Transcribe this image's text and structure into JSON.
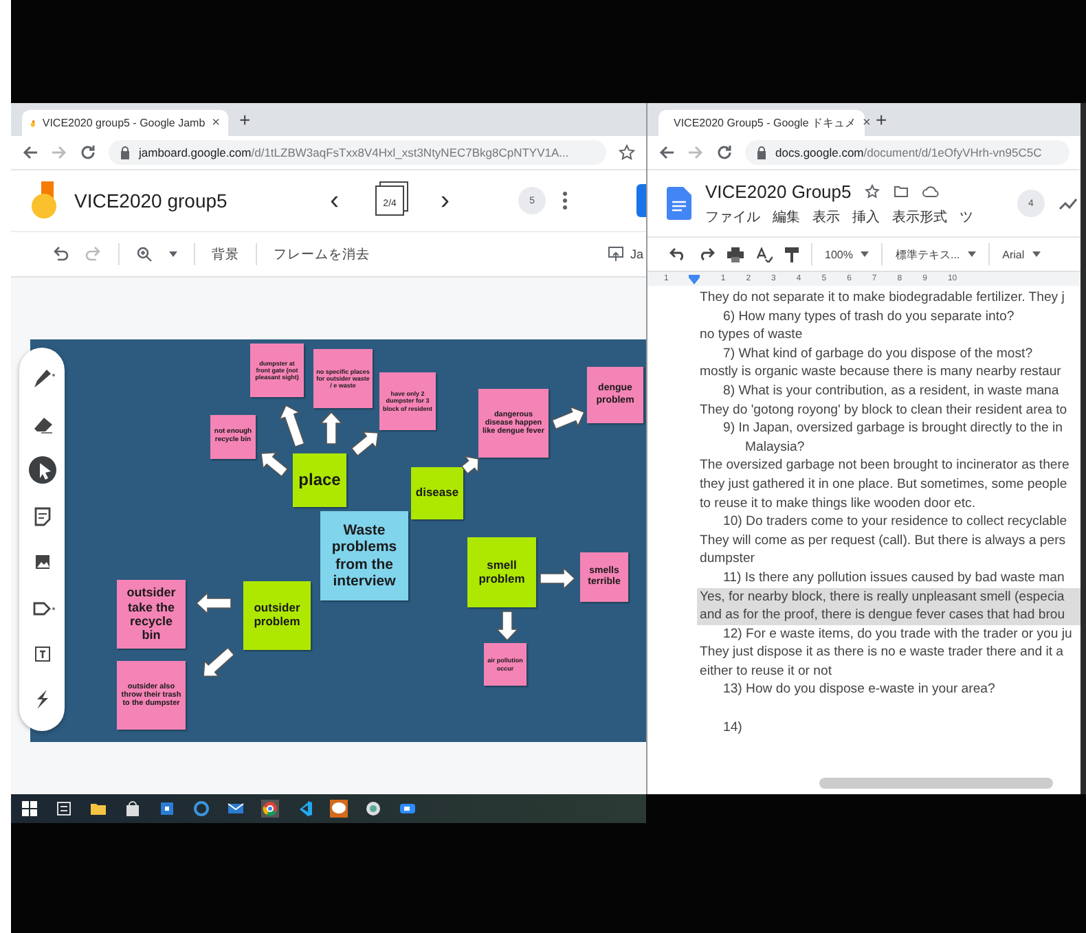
{
  "jamboard_window": {
    "tab_title": "VICE2020 group5 - Google Jamb",
    "tab_close": "×",
    "new_tab": "+",
    "url_host": "jamboard.google.com",
    "url_path": "/d/1tLZBW3aqFsTxx8V4Hxl_xst3NtyNEC7Bkg8CpNTYV1A...",
    "title": "VICE2020 group5",
    "prev": "‹",
    "frame_counter": "2/4",
    "next": "›",
    "collaborators": "5",
    "toolbar": [
      "背景",
      "フレームを消去"
    ],
    "share_label": "Ja",
    "tools": [
      {
        "kind": "pen",
        "selected": false
      },
      {
        "kind": "eraser",
        "selected": false
      },
      {
        "kind": "select",
        "selected": true
      },
      {
        "kind": "sticky",
        "selected": false
      },
      {
        "kind": "image",
        "selected": false
      },
      {
        "kind": "shape",
        "selected": false
      },
      {
        "kind": "textbox",
        "selected": false
      },
      {
        "kind": "laser",
        "selected": false
      }
    ],
    "notes": [
      {
        "text": "dumpster at front gate (not pleasant sight)",
        "color": "#f584b6"
      },
      {
        "text": "no specific places for outsider waste / e waste",
        "color": "#f584b6"
      },
      {
        "text": "have only 2 dumpster for 3 block of resident",
        "color": "#f584b6"
      },
      {
        "text": "not enough recycle bin",
        "color": "#f584b6"
      },
      {
        "text": "place",
        "color": "#aee800"
      },
      {
        "text": "dengue problem",
        "color": "#f584b6"
      },
      {
        "text": "dangerous disease happen like dengue fever",
        "color": "#f584b6"
      },
      {
        "text": "disease",
        "color": "#aee800"
      },
      {
        "text": "Waste problems from the interview",
        "color": "#80d4ec"
      },
      {
        "text": "smell problem",
        "color": "#aee800"
      },
      {
        "text": "smells terrible",
        "color": "#f584b6"
      },
      {
        "text": "outsider take the recycle bin",
        "color": "#f584b6"
      },
      {
        "text": "outsider problem",
        "color": "#aee800"
      },
      {
        "text": "outsider also throw their trash to the dumpster",
        "color": "#f584b6"
      },
      {
        "text": "air pollution occur",
        "color": "#f584b6"
      }
    ]
  },
  "docs_window": {
    "tab_title": "VICE2020 Group5 - Google ドキュメ",
    "tab_close": "×",
    "new_tab": "+",
    "url_host": "docs.google.com",
    "url_path": "/document/d/1eOfyVHrh-vn95C5C",
    "title": "VICE2020 Group5",
    "menu": [
      "ファイル",
      "編集",
      "表示",
      "挿入",
      "表示形式",
      "ツ"
    ],
    "collaborators": "4",
    "zoom": "100%",
    "style": "標準テキス...",
    "font": "Arial",
    "ruler": [
      "1",
      "1",
      "2",
      "3",
      "4",
      "5",
      "6",
      "7",
      "8",
      "9",
      "10"
    ],
    "lines": [
      {
        "kind": "answer",
        "text": "They do not separate it to make biodegradable fertilizer. They j",
        "highlighted": false
      },
      {
        "kind": "question",
        "text": "6)  How many types of trash do you separate into?",
        "highlighted": false
      },
      {
        "kind": "answer",
        "text": "no types of waste",
        "highlighted": false
      },
      {
        "kind": "question",
        "text": "7)  What kind of garbage do you dispose of the most?",
        "highlighted": false
      },
      {
        "kind": "answer",
        "text": "mostly is organic waste because there is many nearby restaur",
        "highlighted": false
      },
      {
        "kind": "question",
        "text": "8)  What is your contribution, as a resident, in waste mana",
        "highlighted": false
      },
      {
        "kind": "answer",
        "text": "They do 'gotong royong' by block to clean their resident area to",
        "highlighted": false
      },
      {
        "kind": "question",
        "text": "9)   In Japan, oversized garbage is brought directly to the in",
        "highlighted": false
      },
      {
        "kind": "continuation",
        "text": "Malaysia?",
        "highlighted": false
      },
      {
        "kind": "answer",
        "text": "The oversized garbage not been brought to incinerator as there",
        "highlighted": false
      },
      {
        "kind": "answer",
        "text": "they just gathered it in one place. But sometimes, some people",
        "highlighted": false
      },
      {
        "kind": "answer",
        "text": "to reuse it to make things like wooden door etc.",
        "highlighted": false
      },
      {
        "kind": "question",
        "text": "10) Do traders come to your residence to collect recyclable",
        "highlighted": false
      },
      {
        "kind": "answer",
        "text": "They will come as per request (call). But there is always a pers",
        "highlighted": false
      },
      {
        "kind": "answer",
        "text": "dumpster",
        "highlighted": false
      },
      {
        "kind": "question",
        "text": "11) Is there any pollution issues caused by bad waste man",
        "highlighted": false
      },
      {
        "kind": "answer",
        "text": "Yes, for nearby block, there is really unpleasant smell (especia",
        "highlighted": true
      },
      {
        "kind": "answer",
        "text": "and as for the proof, there is dengue fever cases that had brou",
        "highlighted": true
      },
      {
        "kind": "question",
        "text": "12) For e waste items, do you trade with the trader or you ju",
        "highlighted": false
      },
      {
        "kind": "answer",
        "text": "They just dispose it as there is no e waste trader there and it a",
        "highlighted": false
      },
      {
        "kind": "answer",
        "text": "either to reuse it or not",
        "highlighted": false
      },
      {
        "kind": "question",
        "text": "13) How do you dispose e-waste in your area?",
        "highlighted": false
      },
      {
        "kind": "question",
        "text": "14)",
        "highlighted": false,
        "space_before": true
      }
    ]
  }
}
